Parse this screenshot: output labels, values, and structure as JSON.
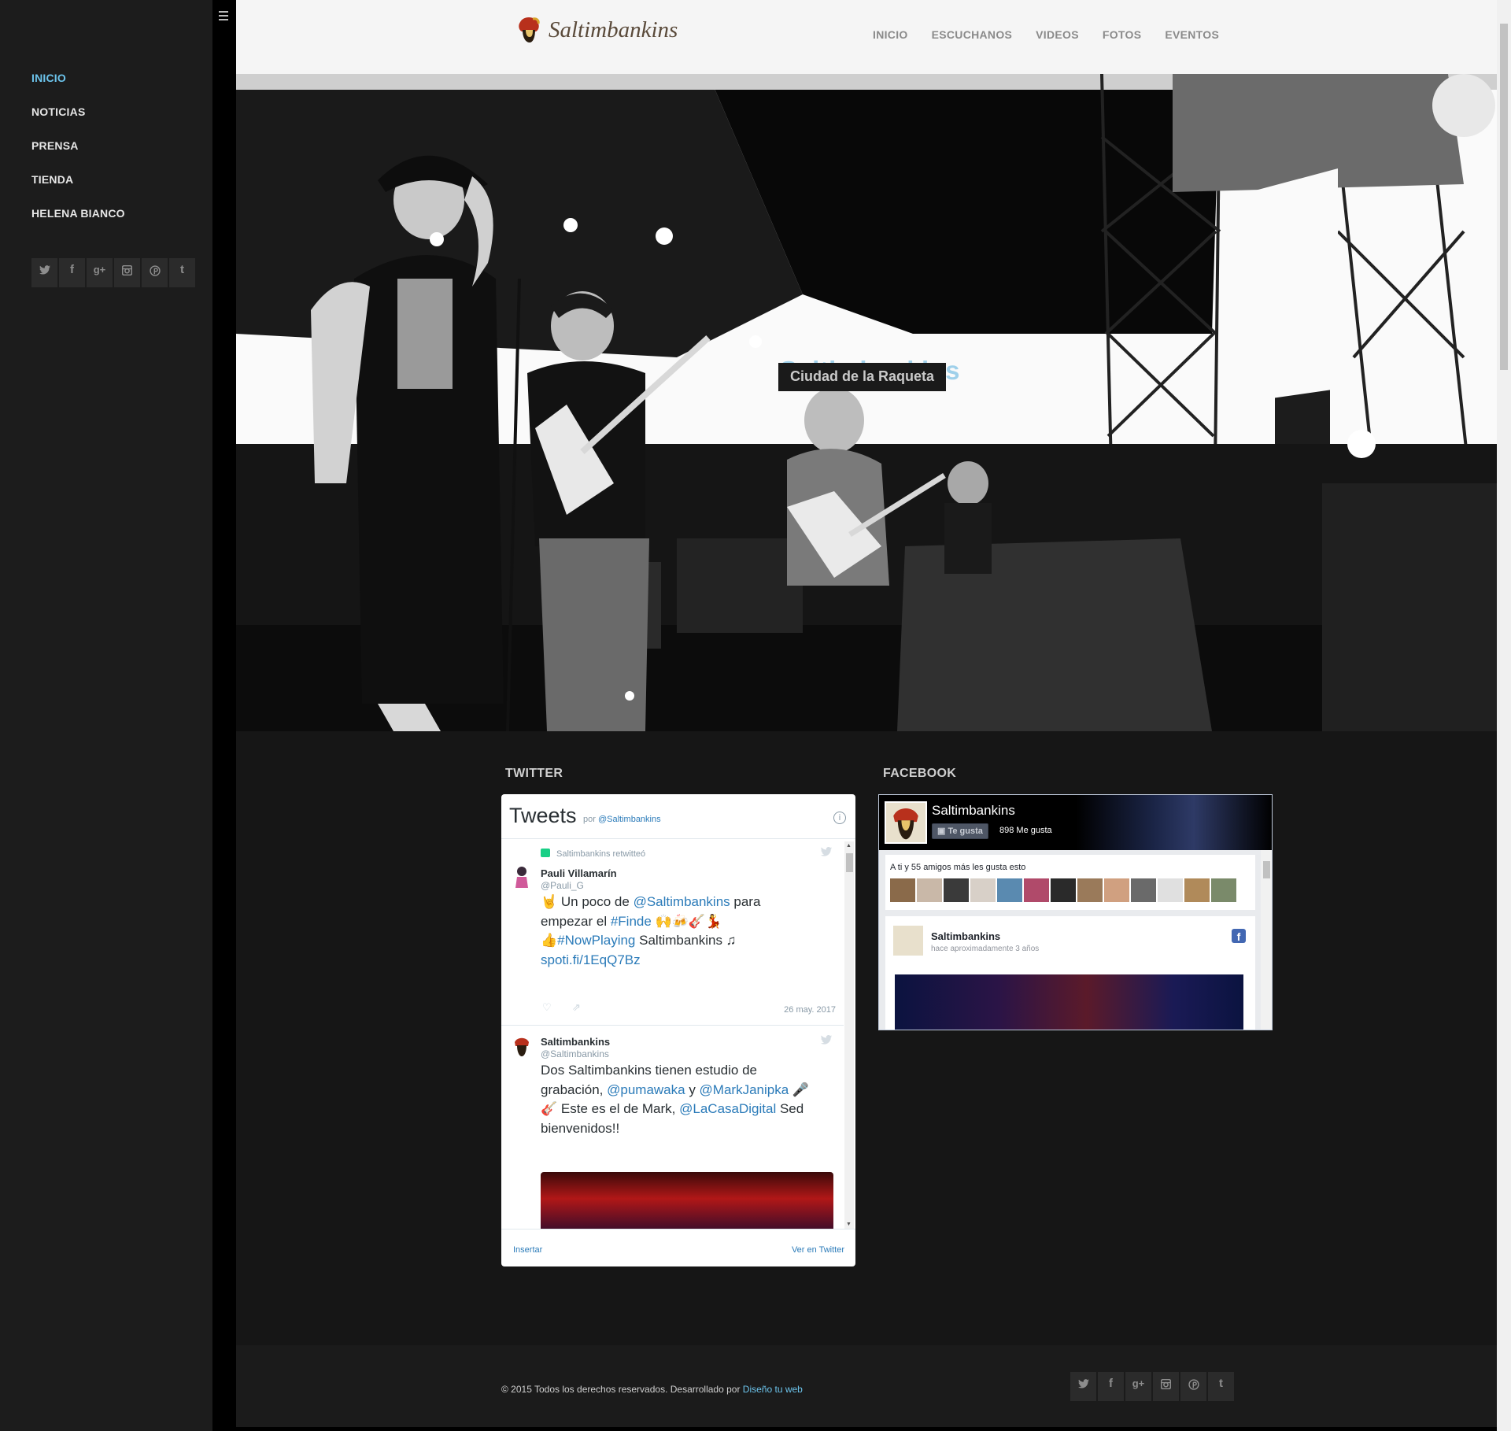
{
  "sidebar": {
    "items": [
      {
        "label": "INICIO",
        "active": true
      },
      {
        "label": "NOTICIAS",
        "active": false
      },
      {
        "label": "PRENSA",
        "active": false
      },
      {
        "label": "TIENDA",
        "active": false
      },
      {
        "label": "HELENA BIANCO",
        "active": false
      }
    ],
    "social": [
      {
        "icon": "twitter-icon",
        "glyph": "🐦"
      },
      {
        "icon": "facebook-icon",
        "glyph": "f"
      },
      {
        "icon": "google-plus-icon",
        "glyph": "g+"
      },
      {
        "icon": "instagram-icon",
        "glyph": "◙"
      },
      {
        "icon": "pinterest-icon",
        "glyph": "℗"
      },
      {
        "icon": "tumblr-icon",
        "glyph": "t"
      }
    ]
  },
  "header": {
    "logo_text": "Saltimbankins",
    "nav": [
      "INICIO",
      "ESCUCHANOS",
      "VIDEOS",
      "FOTOS",
      "EVENTOS"
    ]
  },
  "hero": {
    "title": "Saltimbankins",
    "subtitle": "Ciudad de la Raqueta"
  },
  "twitter": {
    "section_title": "TWITTER",
    "header": "Tweets",
    "by_prefix": "por",
    "by_handle": "@Saltimbankins",
    "tweets": [
      {
        "retweet_note": "Saltimbankins retwitteó",
        "name": "Pauli Villamarín",
        "handle": "@Pauli_G",
        "lines": [
          {
            "pre": "🤘 Un poco de ",
            "link": "@Saltimbankins",
            "post": " para"
          },
          {
            "pre": "empezar el ",
            "link": "#Finde",
            "post": " 🙌🍻🎸💃"
          },
          {
            "pre": "👍",
            "link": "#NowPlaying",
            "post": " Saltimbankins ♫"
          },
          {
            "pre": "",
            "link": "spoti.fi/1EqQ7Bz",
            "post": ""
          }
        ],
        "date": "26 may. 2017"
      },
      {
        "name": "Saltimbankins",
        "handle": "@Saltimbankins",
        "lines": [
          {
            "pre": "Dos Saltimbankins tienen estudio de",
            "link": "",
            "post": ""
          },
          {
            "pre": "grabación, ",
            "link": "@pumawaka",
            "post": " y "
          },
          {
            "pre": "🎸 Este es el de Mark, ",
            "link": "@LaCasaDigital",
            "post": "  Sed"
          },
          {
            "pre": "bienvenidos!!",
            "link": "",
            "post": ""
          }
        ],
        "line2_link2": "@MarkJanipka",
        "line2_emoji": " 🎤"
      }
    ],
    "footer_left": "Insertar",
    "footer_right": "Ver en Twitter"
  },
  "facebook": {
    "section_title": "FACEBOOK",
    "page_name": "Saltimbankins",
    "like_button": "Te gusta",
    "like_count": "898 Me gusta",
    "friends_text": "A ti y 55 amigos más les gusta esto",
    "post_author": "Saltimbankins",
    "post_time": "hace aproximadamente 3 años"
  },
  "footer": {
    "copyright": "© 2015 Todos los derechos reservados. Desarrollado por ",
    "credit_link": "Diseño tu web"
  }
}
